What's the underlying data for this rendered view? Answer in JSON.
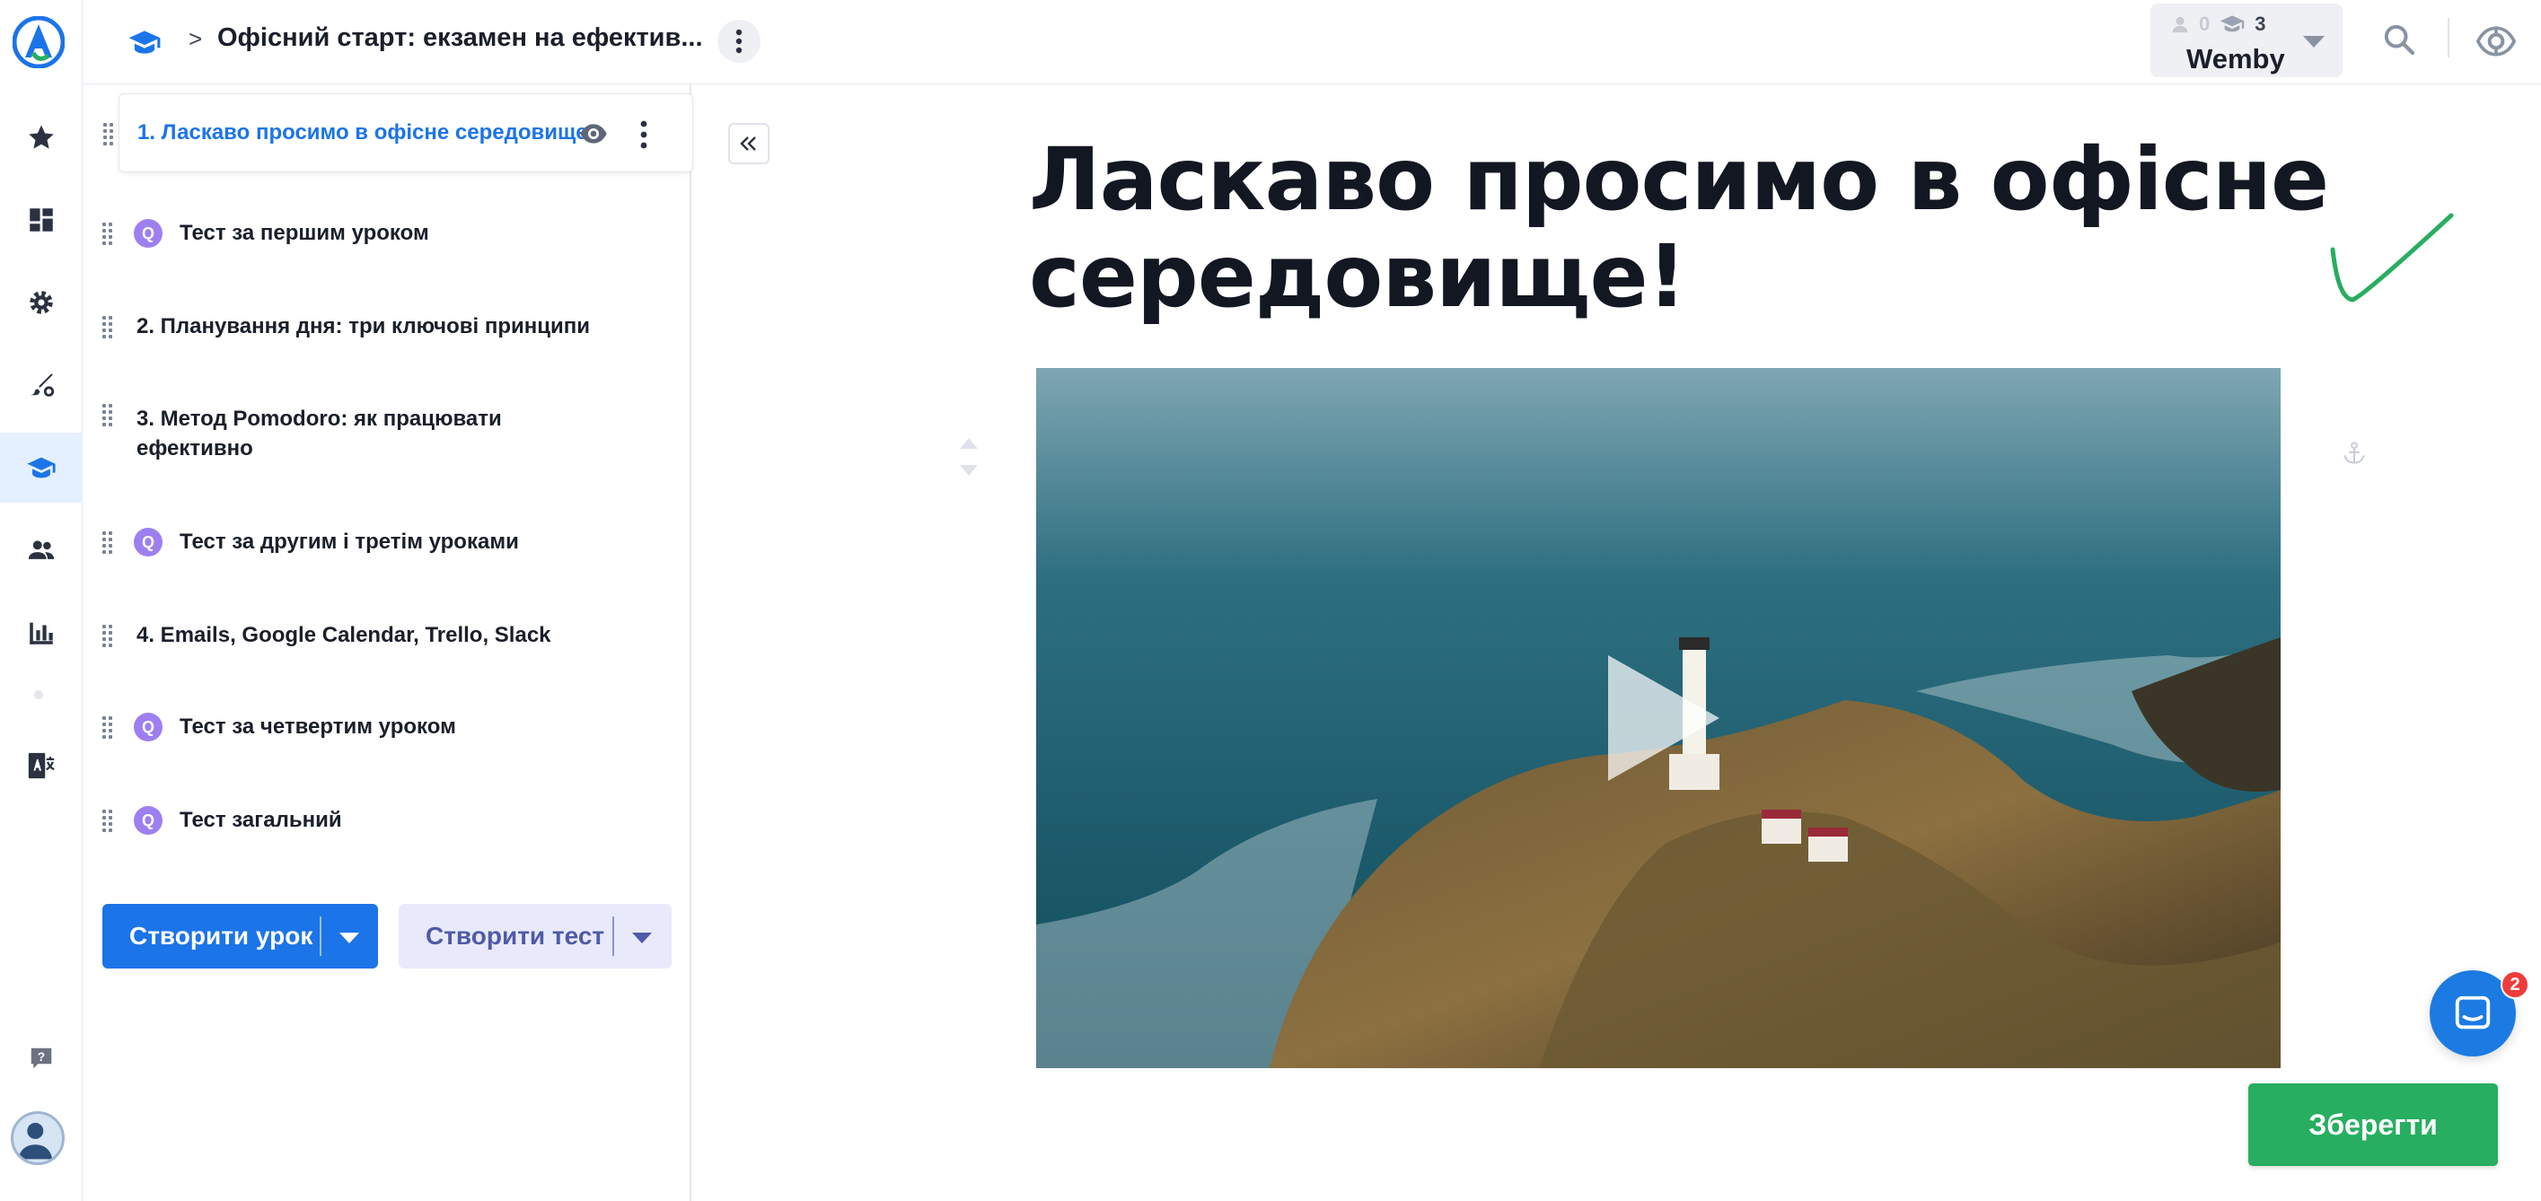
{
  "topbar": {
    "separator": ">",
    "course_title": "Офісний старт: екзамен на ефектив...",
    "user": {
      "name": "Wemby",
      "stat_users": "0",
      "stat_courses": "3"
    }
  },
  "lessons": [
    {
      "label": "1. Ласкаво просимо в офісне середовище!",
      "type": "lesson",
      "active": true
    },
    {
      "label": "Тест за першим уроком",
      "type": "quiz",
      "badge": "Q"
    },
    {
      "label": "2. Планування дня: три ключові принципи",
      "type": "lesson"
    },
    {
      "label": "3. Метод Pomodoro: як працювати ефективно",
      "type": "lesson"
    },
    {
      "label": "Тест за другим і третім уроками",
      "type": "quiz",
      "badge": "Q"
    },
    {
      "label": "4. Emails, Google Calendar, Trello, Slack",
      "type": "lesson"
    },
    {
      "label": "Тест за четвертим уроком",
      "type": "quiz",
      "badge": "Q"
    },
    {
      "label": "Тест загальний",
      "type": "quiz",
      "badge": "Q"
    }
  ],
  "actions": {
    "create_lesson": "Створити урок",
    "create_test": "Створити тест"
  },
  "content": {
    "title": "Ласкаво просимо в офісне середовище!"
  },
  "chat": {
    "unread": "2"
  },
  "save_label": "Зберегти",
  "colors": {
    "primary": "#1c74e9",
    "save": "#27ae60",
    "quiz_badge": "#9e7ff0"
  },
  "icons": {
    "rail": [
      "logo-icon",
      "star-icon",
      "dashboard-icon",
      "gear-icon",
      "design-icon",
      "courses-icon",
      "users-icon",
      "chart-icon",
      "translate-icon",
      "help-icon",
      "avatar"
    ]
  }
}
